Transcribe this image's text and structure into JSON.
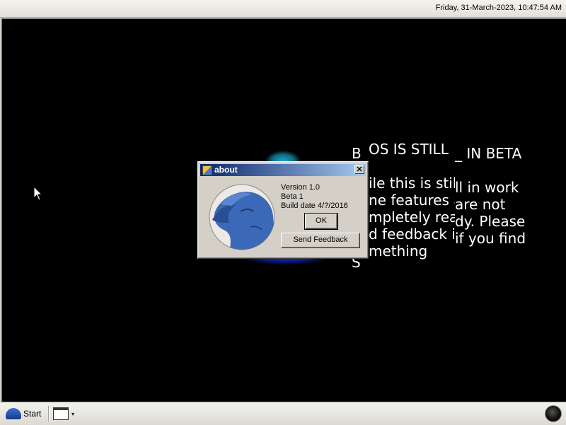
{
  "topbar": {
    "clock": "Friday, 31-March-2023, 10:47:54 AM"
  },
  "background_text": {
    "back_title": "B",
    "front_title": "OS IS STILL",
    "right_title": "_ IN BETA",
    "back_lines": [
      "",
      "",
      "",
      "",
      "S"
    ],
    "front_lines": [
      "ile this is still",
      "ne features a",
      "mpletely ready",
      "d feedback if",
      "mething"
    ],
    "right_lines": [
      "ll in work",
      "are not",
      "dy. Please",
      "if you find"
    ]
  },
  "dialog": {
    "title": "about",
    "close_label": "✕",
    "version": "Version 1.0",
    "beta": "Beta 1",
    "build_date": "Build date 4/?/2016",
    "ok_label": "OK",
    "feedback_label": "Send Feedback"
  },
  "taskbar": {
    "start_label": "Start",
    "dropdown_arrow": "▾"
  },
  "colors": {
    "desktop": "#000000",
    "titlebar_start": "#0a246a",
    "titlebar_end": "#a6caf0",
    "dialog_bg": "#d4d0c8"
  }
}
